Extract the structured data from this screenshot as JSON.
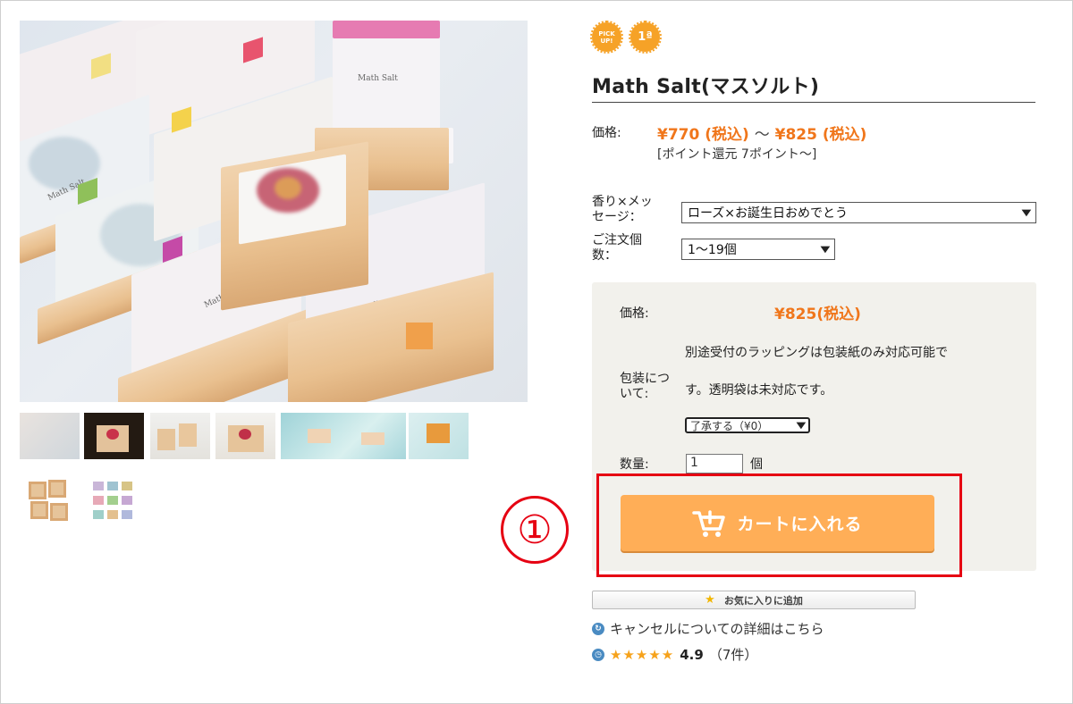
{
  "badges": {
    "pickup": "PICK UP!",
    "first": "1ª"
  },
  "product": {
    "title": "Math Salt(マスソルト)",
    "price_label": "価格:",
    "price_min": "¥770 (税込)",
    "price_sep": "～",
    "price_max": "¥825 (税込)",
    "points": "[ポイント還元 7ポイント～]"
  },
  "image_texts": {
    "brand": "Math Salt"
  },
  "options": {
    "scent_label_1": "香り×メッ",
    "scent_label_2": "セージ：",
    "scent_value": "ローズ×お誕生日おめでとう",
    "order_label_1": "ご注文個",
    "order_label_2": "数：",
    "order_value": "1～19個"
  },
  "panel": {
    "price_label": "価格:",
    "price_value": "¥825(税込)",
    "wrap_note_1": "別途受付のラッピングは包装紙のみ対応可能で",
    "wrap_label_1": "包装につ",
    "wrap_label_2": "いて:",
    "wrap_note_2": "す。透明袋は未対応です。",
    "wrap_select": "了承する（¥0）",
    "qty_label": "数量:",
    "qty_value": "1",
    "qty_unit": "個"
  },
  "cart": {
    "label": "カートに入れる"
  },
  "annotation": {
    "number": "①"
  },
  "favorite": {
    "label": "お気に入りに追加"
  },
  "cancel": {
    "text": "キャンセルについての詳細はこちら"
  },
  "review": {
    "stars": "★★★★★",
    "rating": "4.9",
    "count": "（7件）"
  },
  "colors": {
    "accent_orange": "#f0761b",
    "button": "#ffae57",
    "highlight_red": "#e60012",
    "panel_bg": "#f2f1ec"
  }
}
